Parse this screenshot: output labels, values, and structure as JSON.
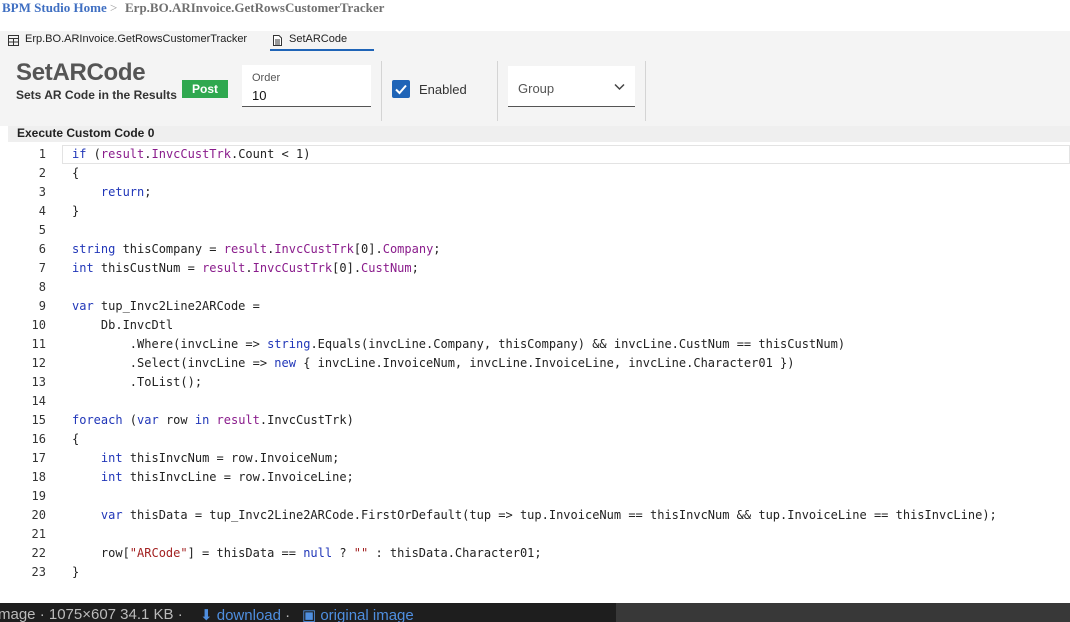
{
  "breadcrumb": {
    "home": "BPM Studio Home",
    "separator": ">",
    "current": "Erp.BO.ARInvoice.GetRowsCustomerTracker"
  },
  "tabs": [
    {
      "label": "Erp.BO.ARInvoice.GetRowsCustomerTracker",
      "icon": "table-icon",
      "active": false
    },
    {
      "label": "SetARCode",
      "icon": "document-icon",
      "active": true
    }
  ],
  "header": {
    "title": "SetARCode",
    "subtitle": "Sets AR Code in the Results",
    "badge": "Post",
    "order": {
      "label": "Order",
      "value": "10"
    },
    "enabled": {
      "label": "Enabled",
      "checked": true
    },
    "group": {
      "placeholder": "Group"
    }
  },
  "section": {
    "title": "Execute Custom Code 0"
  },
  "code": {
    "line_numbers": [
      "1",
      "2",
      "3",
      "4",
      "5",
      "6",
      "7",
      "8",
      "9",
      "10",
      "11",
      "12",
      "13",
      "14",
      "15",
      "16",
      "17",
      "18",
      "19",
      "20",
      "21",
      "22",
      "23"
    ],
    "lines": [
      "if (result.InvcCustTrk.Count < 1)",
      "{",
      "    return;",
      "}",
      "",
      "string thisCompany = result.InvcCustTrk[0].Company;",
      "int thisCustNum = result.InvcCustTrk[0].CustNum;",
      "",
      "var tup_Invc2Line2ARCode =",
      "    Db.InvcDtl",
      "        .Where(invcLine => string.Equals(invcLine.Company, thisCompany) && invcLine.CustNum == thisCustNum)",
      "        .Select(invcLine => new { invcLine.InvoiceNum, invcLine.InvoiceLine, invcLine.Character01 })",
      "        .ToList();",
      "",
      "foreach (var row in result.InvcCustTrk)",
      "{",
      "    int thisInvcNum = row.InvoiceNum;",
      "    int thisInvcLine = row.InvoiceLine;",
      "",
      "    var thisData = tup_Invc2Line2ARCode.FirstOrDefault(tup => tup.InvoiceNum == thisInvcNum && tup.InvoiceLine == thisInvcLine);",
      "",
      "    row[\"ARCode\"] = thisData == null ? \"\" : thisData.Character01;",
      "}"
    ]
  },
  "bottombar": {
    "info": "mage · 1075×607 34.1 KB ·",
    "download": "download",
    "separator": "·",
    "original": "original image"
  },
  "colors": {
    "accent": "#1f64b7",
    "badge": "#2fa84f",
    "keyword": "#2036b8",
    "property": "#8a1c8c",
    "string": "#a32222",
    "link": "#3f6fc2"
  }
}
